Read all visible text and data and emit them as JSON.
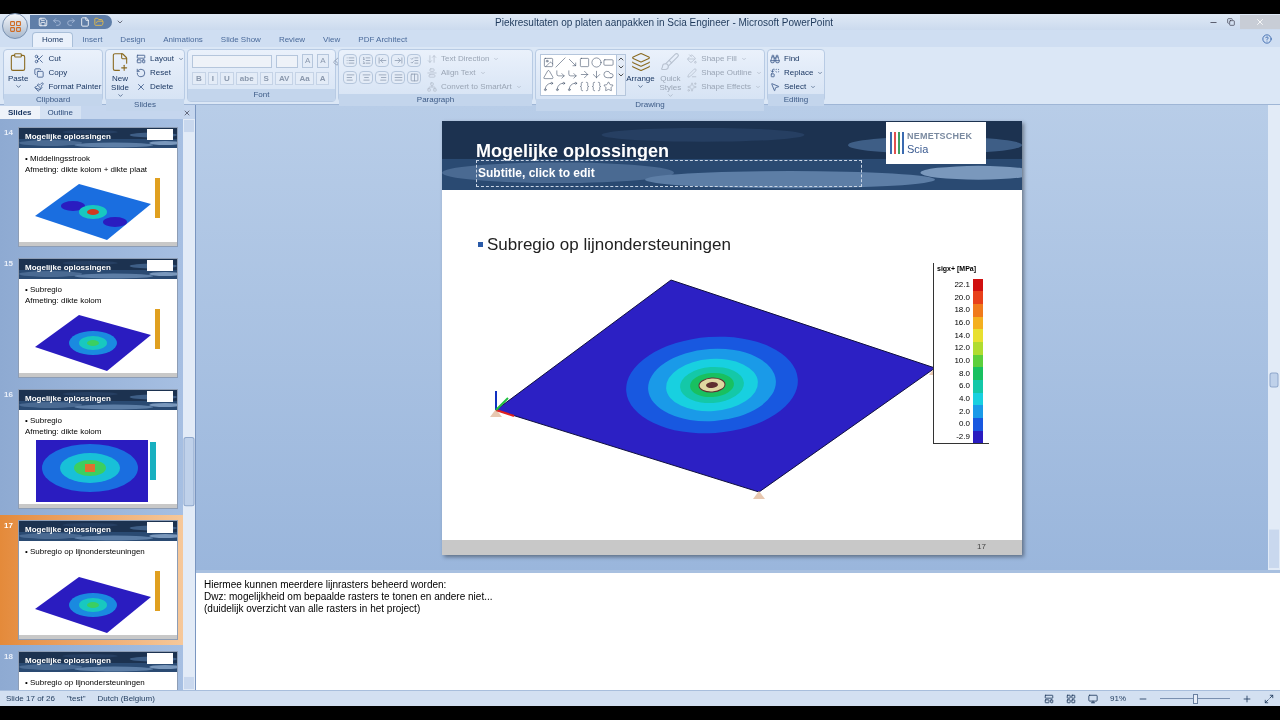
{
  "window": {
    "title": "Piekresultaten op platen aanpakken in Scia Engineer - Microsoft PowerPoint"
  },
  "ribbon_tabs": [
    {
      "label": "Home",
      "selected": true
    },
    {
      "label": "Insert",
      "selected": false
    },
    {
      "label": "Design",
      "selected": false
    },
    {
      "label": "Animations",
      "selected": false
    },
    {
      "label": "Slide Show",
      "selected": false
    },
    {
      "label": "Review",
      "selected": false
    },
    {
      "label": "View",
      "selected": false
    },
    {
      "label": "PDF Architect",
      "selected": false
    }
  ],
  "ribbon_groups": [
    {
      "label": "Clipboard",
      "kind": "plain",
      "large": [
        {
          "label": "Paste",
          "disabled": false,
          "has_menu": true
        }
      ],
      "small": [
        {
          "label": "Cut",
          "disabled": false,
          "has_menu": false
        },
        {
          "label": "Copy",
          "disabled": false,
          "has_menu": false
        },
        {
          "label": "Format Painter",
          "disabled": false,
          "has_menu": false
        }
      ]
    },
    {
      "label": "Slides",
      "kind": "plain",
      "large": [
        {
          "label": "New Slide",
          "disabled": false,
          "has_menu": true
        }
      ],
      "small": [
        {
          "label": "Layout",
          "disabled": false,
          "has_menu": true
        },
        {
          "label": "Reset",
          "disabled": false,
          "has_menu": false
        },
        {
          "label": "Delete",
          "disabled": false,
          "has_menu": false
        }
      ]
    },
    {
      "label": "Font",
      "kind": "font",
      "glyph_rows": [
        [
          "A",
          "A"
        ],
        [
          "B",
          "I",
          "U",
          "abe",
          "S",
          "AV",
          "Aa",
          "A"
        ]
      ]
    },
    {
      "label": "Paragraph",
      "kind": "paragraph",
      "small": [
        {
          "label": "Text Direction",
          "disabled": true,
          "has_menu": true
        },
        {
          "label": "Align Text",
          "disabled": true,
          "has_menu": true
        },
        {
          "label": "Convert to SmartArt",
          "disabled": true,
          "has_menu": true
        }
      ]
    },
    {
      "label": "Drawing",
      "kind": "drawing",
      "large": [
        {
          "label": "Arrange",
          "disabled": false,
          "has_menu": true
        },
        {
          "label": "Quick Styles",
          "disabled": true,
          "has_menu": true
        }
      ],
      "small": [
        {
          "label": "Shape Fill",
          "disabled": true,
          "has_menu": true
        },
        {
          "label": "Shape Outline",
          "disabled": true,
          "has_menu": true
        },
        {
          "label": "Shape Effects",
          "disabled": true,
          "has_menu": true
        }
      ]
    },
    {
      "label": "Editing",
      "kind": "plain",
      "small": [
        {
          "label": "Find",
          "disabled": false,
          "has_menu": false
        },
        {
          "label": "Replace",
          "disabled": false,
          "has_menu": true
        },
        {
          "label": "Select",
          "disabled": false,
          "has_menu": true
        }
      ]
    }
  ],
  "panel_tabs": [
    {
      "label": "Slides",
      "selected": true
    },
    {
      "label": "Outline",
      "selected": false
    }
  ],
  "thumbnails": [
    {
      "number": "14",
      "selected": false,
      "title": "Mogelijke oplossingen",
      "bullets": [
        "• Middelingsstrook",
        "Afmeting: dikte kolom + dikte plaat"
      ],
      "kind": "peaks"
    },
    {
      "number": "15",
      "selected": false,
      "title": "Mogelijke oplossingen",
      "bullets": [
        "• Subregio",
        "Afmeting: dikte kolom"
      ],
      "kind": "plate"
    },
    {
      "number": "16",
      "selected": false,
      "title": "Mogelijke oplossingen",
      "bullets": [
        "• Subregio",
        "Afmeting: dikte kolom"
      ],
      "kind": "plan"
    },
    {
      "number": "17",
      "selected": true,
      "title": "Mogelijke oplossingen",
      "bullets": [
        "• Subregio op lijnondersteuningen"
      ],
      "kind": "plate"
    },
    {
      "number": "18",
      "selected": false,
      "title": "Mogelijke oplossingen",
      "bullets": [
        "• Subregio op lijnondersteuningen"
      ],
      "kind": "none"
    }
  ],
  "slide": {
    "title": "Mogelijke oplossingen",
    "subtitle_placeholder": "Subtitle, click to edit",
    "logo": {
      "name": "NEMETSCHEK",
      "sub": "Scia"
    },
    "bullet": "Subregio op lijnondersteuningen",
    "legend": {
      "title": "sigx+ [MPa]",
      "items": [
        {
          "label": "22.1",
          "color": "#d01010"
        },
        {
          "label": "20.0",
          "color": "#e8401a"
        },
        {
          "label": "18.0",
          "color": "#f07a1c"
        },
        {
          "label": "16.0",
          "color": "#f4b020"
        },
        {
          "label": "14.0",
          "color": "#e8e030"
        },
        {
          "label": "12.0",
          "color": "#b0dc30"
        },
        {
          "label": "10.0",
          "color": "#5ccf3c"
        },
        {
          "label": "8.0",
          "color": "#18c060"
        },
        {
          "label": "6.0",
          "color": "#14c8a8"
        },
        {
          "label": "4.0",
          "color": "#18d0e0"
        },
        {
          "label": "2.0",
          "color": "#1a9ae8"
        },
        {
          "label": "0.0",
          "color": "#1858e0"
        },
        {
          "label": "-2.9",
          "color": "#2a1cc0"
        }
      ]
    },
    "page_number": "17"
  },
  "notes": [
    "Hiermee kunnen meerdere lijnrasters beheerd worden:",
    "Dwz: mogelijkheid om bepaalde rasters te tonen en andere niet...",
    "(duidelijk overzicht van alle rasters in het project)"
  ],
  "status_bar": {
    "slide": "Slide 17 of 26",
    "theme": "\"test\"",
    "language": "Dutch (Belgium)",
    "zoom": "91%",
    "zoom_slider": {
      "level": 0.5
    }
  }
}
